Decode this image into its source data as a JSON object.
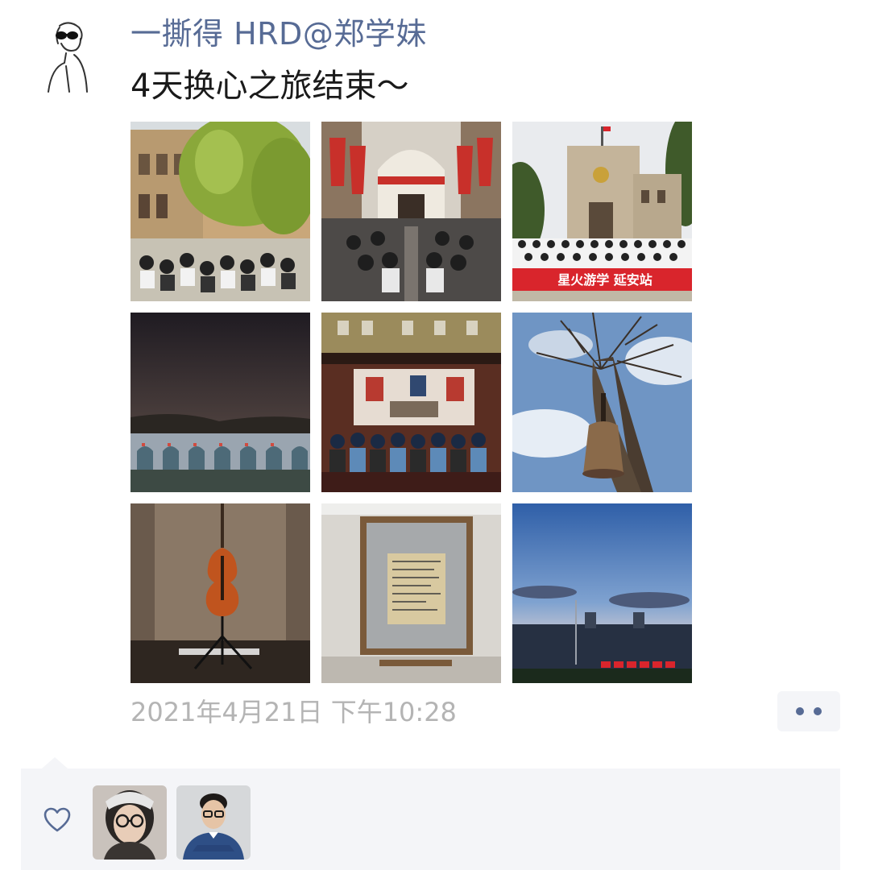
{
  "post": {
    "author": "一撕得 HRD@郑学妹",
    "text": "4天换心之旅结束～",
    "timestamp": "2021年4月21日 下午10:28"
  },
  "photos": [
    {
      "label": "campus-courtyard-group-photo",
      "banner": ""
    },
    {
      "label": "hall-with-red-flags-audience",
      "banner": ""
    },
    {
      "label": "building-group-photo-banner",
      "banner": "星火游学  延安站"
    },
    {
      "label": "night-sky-cave-dwellings",
      "banner": ""
    },
    {
      "label": "exhibition-hall-screen-audience",
      "banner": ""
    },
    {
      "label": "tree-with-bell",
      "banner": ""
    },
    {
      "label": "violin-exhibit",
      "banner": ""
    },
    {
      "label": "framed-manuscript",
      "banner": ""
    },
    {
      "label": "dusk-sky-building",
      "banner": ""
    }
  ],
  "actions": {
    "more_icon": "more-dots-icon",
    "like_icon": "heart-icon"
  },
  "likes": [
    {
      "avatar": "woman-glasses-avatar"
    },
    {
      "avatar": "man-blue-shirt-avatar"
    }
  ],
  "colors": {
    "author_name": "#576b95",
    "timestamp": "#b4b4b4",
    "panel_bg": "#f4f5f8",
    "banner_red": "#d9252c"
  }
}
